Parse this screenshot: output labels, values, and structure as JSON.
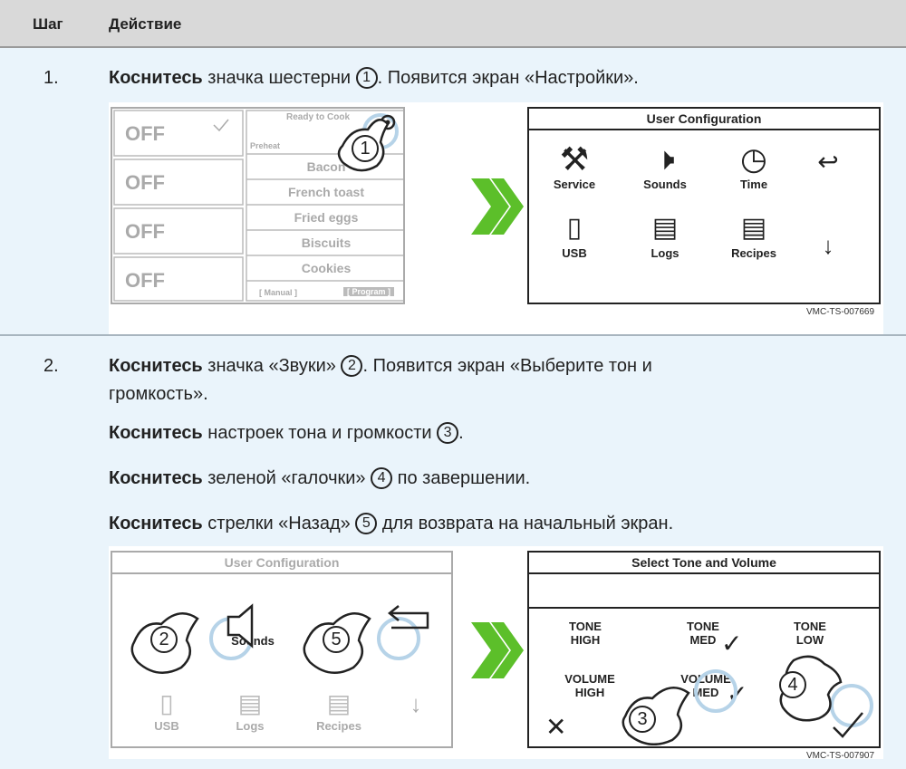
{
  "header": {
    "col_step": "Шаг",
    "col_action": "Действие"
  },
  "step1": {
    "num": "1.",
    "line1_bold": "Коснитесь",
    "line1_a": " значка шестерни ",
    "marker": "1",
    "line1_b": ". Появится экран «Настройки».",
    "fig_code": "VMC-TS-007669",
    "oven_screen": {
      "off_labels": [
        "OFF",
        "OFF",
        "OFF",
        "OFF"
      ],
      "status": "Ready to Cook",
      "preheat": "Preheat",
      "menu": [
        "Bacon",
        "French toast",
        "Fried eggs",
        "Biscuits",
        "Cookies"
      ],
      "manual": "[ Manual ]",
      "program": "[ Program ]"
    },
    "config_screen": {
      "title": "User Configuration",
      "items": [
        "Service",
        "Sounds",
        "Time",
        "USB",
        "Logs",
        "Recipes"
      ]
    }
  },
  "step2": {
    "num": "2.",
    "p1_bold": "Коснитесь",
    "p1_a": " значка «Звуки» ",
    "p1_marker": "2",
    "p1_b": ". Появится экран «Выберите тон и",
    "p1_c": "громкость».",
    "p2_bold": "Коснитесь",
    "p2_a": " настроек тона и громкости ",
    "p2_marker": "3",
    "p2_b": ".",
    "p3_bold": "Коснитесь",
    "p3_a": " зеленой «галочки» ",
    "p3_marker": "4",
    "p3_b": " по завершении.",
    "p4_bold": "Коснитесь",
    "p4_a": " стрелки «Назад» ",
    "p4_marker": "5",
    "p4_b": " для возврата на начальный экран.",
    "fig_code": "VMC-TS-007907",
    "config_screen": {
      "title": "User Configuration",
      "items": [
        "Sounds",
        "USB",
        "Logs",
        "Recipes"
      ]
    },
    "tone_screen": {
      "title": "Select Tone and Volume",
      "tone_high": [
        "TONE",
        "HIGH"
      ],
      "tone_med": [
        "TONE",
        "MED"
      ],
      "tone_low": [
        "TONE",
        "LOW"
      ],
      "vol_high": [
        "VOLUME",
        "HIGH"
      ],
      "vol_med": [
        "VOLUME",
        "MED"
      ]
    }
  },
  "colors": {
    "header_bg": "#d9d9d9",
    "row_bg": "#eaf4fb",
    "arrow_green": "#5cbf2a",
    "touch_ring": "#b6d3e8"
  }
}
